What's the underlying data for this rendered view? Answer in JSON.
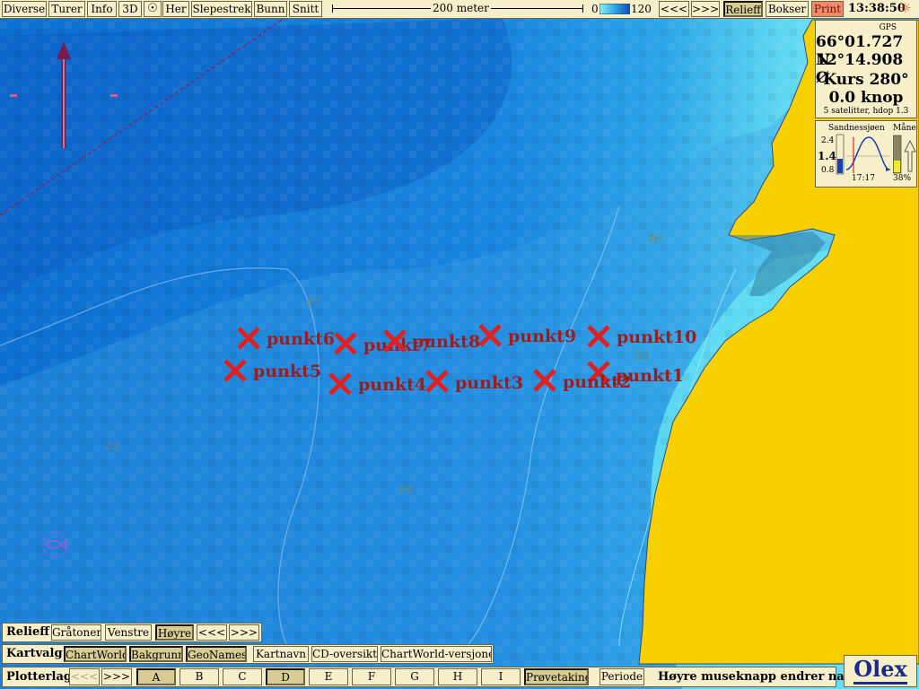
{
  "toolbar": {
    "items": [
      "Diverse",
      "Turer",
      "Info",
      "3D",
      "Her",
      "Slepestrek",
      "Bunn",
      "Snitt"
    ],
    "scale_label": "200 meter",
    "depth_min": "0",
    "depth_max": "120",
    "prev": "<<<",
    "next": ">>>",
    "relieff": "Relieff",
    "bokser": "Bokser",
    "print": "Print",
    "time": "13:38:50"
  },
  "gps": {
    "title": "GPS",
    "lat": "66°01.727 N",
    "lon": "12°14.908 Ø",
    "course": "Kurs 280°",
    "speed": "0.0 knop",
    "sats": "5 satelitter, hdop 1.3"
  },
  "tide": {
    "place": "Sandnessjøen",
    "moon_label": "Måne",
    "high": "2.4",
    "current": "1.4",
    "low": "0.8",
    "time": "17:17",
    "moon_pct": "38%"
  },
  "map": {
    "depths": [
      "47",
      "40",
      "33",
      "22",
      "59"
    ],
    "points": [
      {
        "name": "punkt1"
      },
      {
        "name": "punkt2"
      },
      {
        "name": "punkt3"
      },
      {
        "name": "punkt4"
      },
      {
        "name": "punkt5"
      },
      {
        "name": "punkt6"
      },
      {
        "name": "punkt7"
      },
      {
        "name": "punkt8"
      },
      {
        "name": "punkt9"
      },
      {
        "name": "punkt10"
      }
    ]
  },
  "relieff_bar": {
    "title": "Relieff",
    "items": [
      "Gråtoner",
      "Venstre",
      "Høyre",
      "<<<",
      ">>>"
    ]
  },
  "kartvalg_bar": {
    "title": "Kartvalg",
    "items": [
      "ChartWorld",
      "Bakgrunn",
      "GeoNames",
      "Kartnavn",
      "CD-oversikt",
      "ChartWorld-versjoner"
    ]
  },
  "plotterlag_bar": {
    "title": "Plotterlag",
    "prev": "<<<",
    "next": ">>>",
    "layers": [
      "A",
      "B",
      "C",
      "D",
      "E",
      "F",
      "G",
      "H",
      "I"
    ],
    "provetaking": "Prøvetaking",
    "periode": "Periode",
    "hint": "Høyre museknapp endrer navn"
  },
  "logo": "Olex",
  "colors": {
    "deep": "#0d6fd0",
    "shallow": "#5fe3f3",
    "land": "#f8d000",
    "marker": "#e02020",
    "label": "#a01b1b"
  }
}
